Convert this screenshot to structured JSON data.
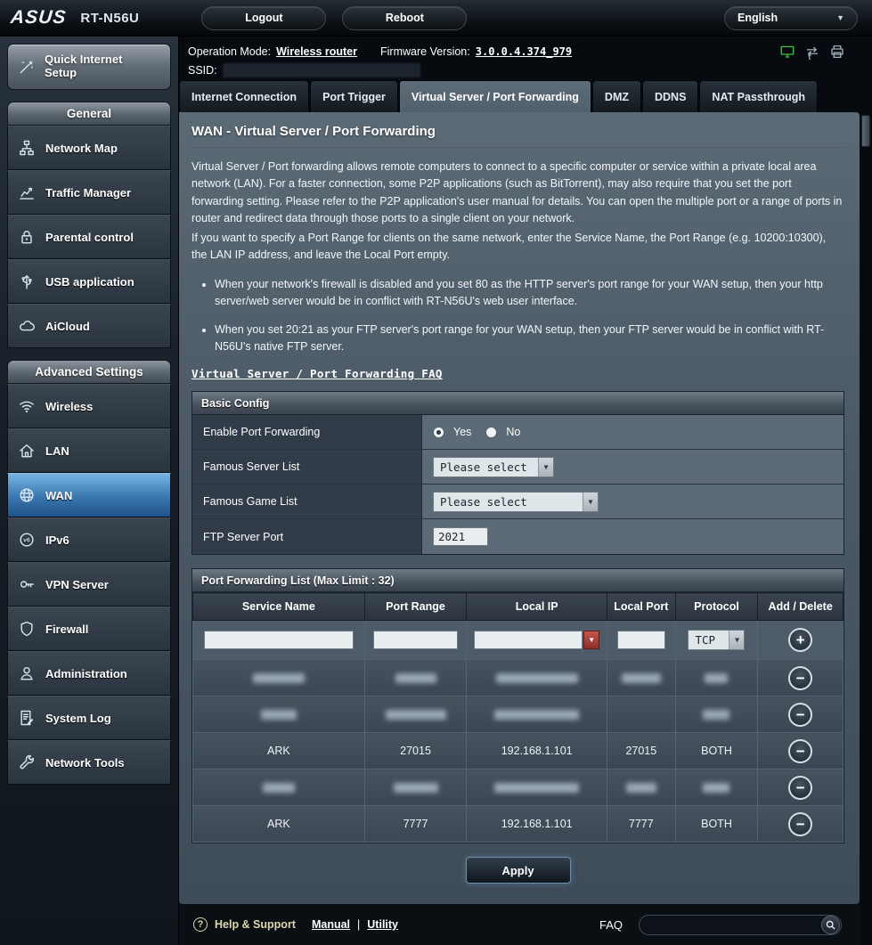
{
  "topbar": {
    "brand": "ASUS",
    "model": "RT-N56U",
    "logout": "Logout",
    "reboot": "Reboot",
    "language": "English"
  },
  "infobar": {
    "operation_mode_label": "Operation Mode:",
    "operation_mode_value": "Wireless router",
    "firmware_label": "Firmware Version:",
    "firmware_value": "3.0.0.4.374_979",
    "ssid_label": "SSID:",
    "icons": [
      "lan-status-icon",
      "switch-icon",
      "printer-icon"
    ]
  },
  "tabs": [
    {
      "label": "Internet Connection",
      "active": false
    },
    {
      "label": "Port Trigger",
      "active": false
    },
    {
      "label": "Virtual Server / Port Forwarding",
      "active": true
    },
    {
      "label": "DMZ",
      "active": false
    },
    {
      "label": "DDNS",
      "active": false
    },
    {
      "label": "NAT Passthrough",
      "active": false
    }
  ],
  "sidebar": {
    "quick_setup_label": "Quick Internet Setup",
    "sections": [
      {
        "header": "General",
        "items": [
          {
            "label": "Network Map",
            "icon": "network-map-icon",
            "active": false
          },
          {
            "label": "Traffic Manager",
            "icon": "traffic-chart-icon",
            "active": false
          },
          {
            "label": "Parental control",
            "icon": "lock-icon",
            "active": false
          },
          {
            "label": "USB application",
            "icon": "usb-icon",
            "active": false
          },
          {
            "label": "AiCloud",
            "icon": "cloud-icon",
            "active": false
          }
        ]
      },
      {
        "header": "Advanced Settings",
        "items": [
          {
            "label": "Wireless",
            "icon": "wifi-icon",
            "active": false
          },
          {
            "label": "LAN",
            "icon": "house-icon",
            "active": false
          },
          {
            "label": "WAN",
            "icon": "globe-icon",
            "active": true
          },
          {
            "label": "IPv6",
            "icon": "ipv6-icon",
            "active": false
          },
          {
            "label": "VPN Server",
            "icon": "key-icon",
            "active": false
          },
          {
            "label": "Firewall",
            "icon": "shield-icon",
            "active": false
          },
          {
            "label": "Administration",
            "icon": "person-icon",
            "active": false
          },
          {
            "label": "System Log",
            "icon": "log-icon",
            "active": false
          },
          {
            "label": "Network Tools",
            "icon": "wrench-icon",
            "active": false
          }
        ]
      }
    ]
  },
  "content": {
    "title": "WAN - Virtual Server / Port Forwarding",
    "intro_1": "Virtual Server / Port forwarding allows remote computers to connect to a specific computer or service within a private local area network (LAN). For a faster connection, some P2P applications (such as BitTorrent), may also require that you set the port forwarding setting. Please refer to the P2P application's user manual for details. You can open the multiple port or a range of ports in router and redirect data through those ports to a single client on your network.",
    "intro_2": "If you want to specify a Port Range for clients on the same network, enter the Service Name, the Port Range (e.g. 10200:10300), the LAN IP address, and leave the Local Port empty.",
    "bullets": [
      "When your network's firewall is disabled and you set 80 as the HTTP server's port range for your WAN setup, then your http server/web server would be in conflict with RT-N56U's web user interface.",
      "When you set 20:21 as your FTP server's port range for your WAN setup, then your FTP server would be in conflict with RT-N56U's native FTP server."
    ],
    "faq_link": "Virtual Server / Port Forwarding FAQ"
  },
  "basic_config": {
    "header": "Basic Config",
    "enable_label": "Enable Port Forwarding",
    "yes_label": "Yes",
    "no_label": "No",
    "enable_value": "Yes",
    "famous_server_label": "Famous Server List",
    "famous_server_value": "Please select",
    "famous_game_label": "Famous Game List",
    "famous_game_value": "Please select",
    "ftp_port_label": "FTP Server Port",
    "ftp_port_value": "2021"
  },
  "port_forwarding": {
    "header": "Port Forwarding List (Max Limit : 32)",
    "columns": [
      "Service Name",
      "Port Range",
      "Local IP",
      "Local Port",
      "Protocol",
      "Add / Delete"
    ],
    "protocol_default": "TCP",
    "rows": [
      {
        "redacted": true,
        "service_name": "",
        "port_range": "",
        "local_ip": "",
        "local_port": "",
        "protocol": "",
        "redacted_widths": [
          58,
          46,
          92,
          44,
          26
        ]
      },
      {
        "redacted": true,
        "service_name": "",
        "port_range": "",
        "local_ip": "",
        "local_port": "",
        "protocol": "",
        "redacted_widths": [
          40,
          68,
          95,
          0,
          30
        ]
      },
      {
        "redacted": false,
        "service_name": "ARK",
        "port_range": "27015",
        "local_ip": "192.168.1.101",
        "local_port": "27015",
        "protocol": "BOTH"
      },
      {
        "redacted": true,
        "service_name": "",
        "port_range": "",
        "local_ip": "",
        "local_port": "",
        "protocol": "",
        "redacted_widths": [
          36,
          50,
          95,
          34,
          30
        ]
      },
      {
        "redacted": false,
        "service_name": "ARK",
        "port_range": "7777",
        "local_ip": "192.168.1.101",
        "local_port": "7777",
        "protocol": "BOTH"
      }
    ],
    "apply_label": "Apply"
  },
  "footer": {
    "help_icon_glyph": "?",
    "help_label": "Help & Support",
    "manual_label": "Manual",
    "separator": "|",
    "utility_label": "Utility",
    "faq_label": "FAQ"
  },
  "colors": {
    "accent_blue": "#3a76ae",
    "status_green": "#3fc53f",
    "combo_red": "#a93b31"
  }
}
